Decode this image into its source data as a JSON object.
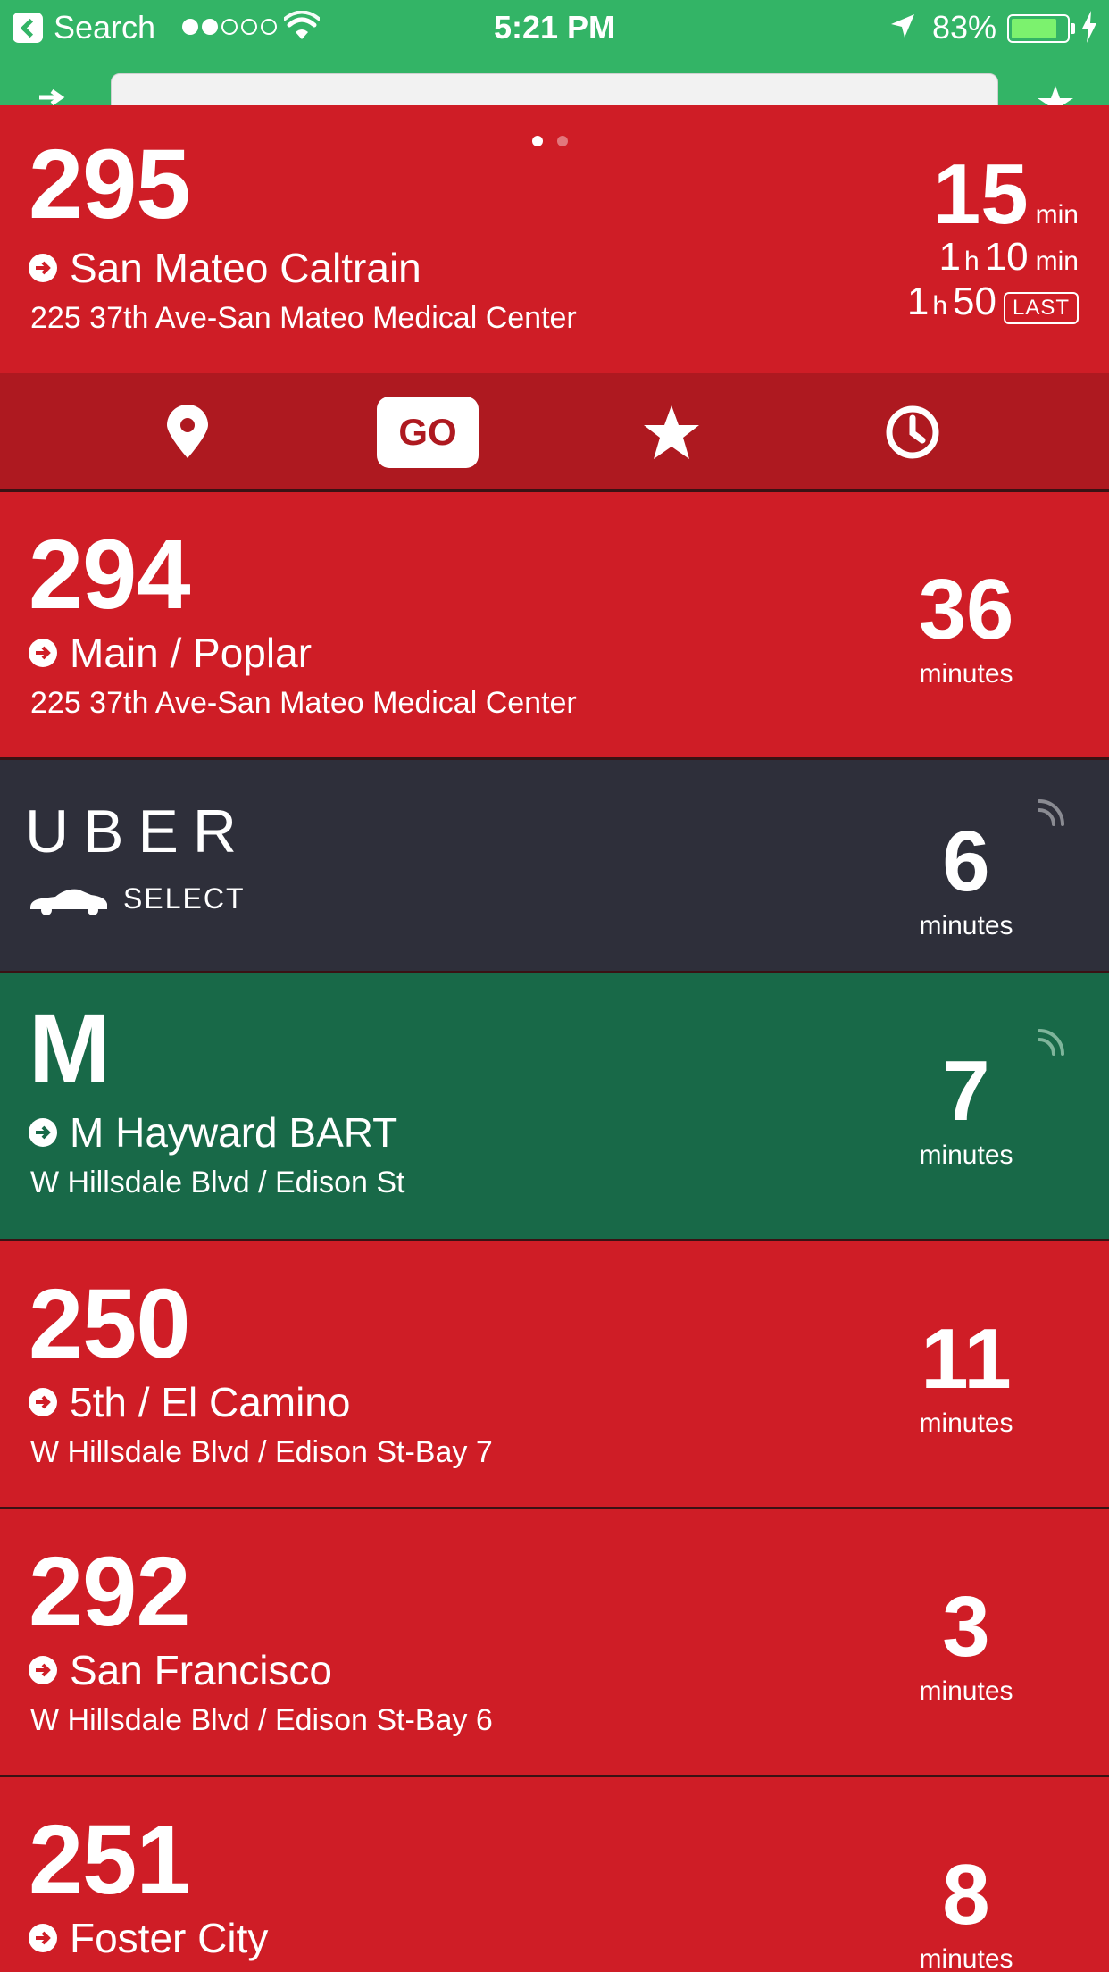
{
  "status_bar": {
    "back_label": "Search",
    "time": "5:21 PM",
    "battery_percent": "83%",
    "battery_level": 0.83,
    "signal_bars_filled": 2,
    "signal_bars_total": 5
  },
  "pager": {
    "pages": 2,
    "active": 1
  },
  "first_card": {
    "route": "295",
    "destination": "San Mateo Caltrain",
    "stop": "225 37th Ave-San Mateo Medical Center",
    "times": [
      {
        "hours": "",
        "minutes": "15",
        "unit": "min"
      },
      {
        "hours": "1",
        "hour_unit": "h",
        "minutes": "10",
        "unit": "min"
      },
      {
        "hours": "1",
        "hour_unit": "h",
        "minutes": "50",
        "badge": "LAST"
      }
    ]
  },
  "actions": {
    "go_label": "GO",
    "icons": [
      "location-pin-icon",
      "star-icon",
      "clock-icon"
    ]
  },
  "cards": [
    {
      "route": "294",
      "destination": "Main / Poplar",
      "stop": "225 37th Ave-San Mateo Medical Center",
      "eta": "36",
      "eta_unit": "minutes",
      "color": "#cf1d26"
    },
    {
      "brand": "UBER",
      "service": "SELECT",
      "eta": "6",
      "eta_unit": "minutes",
      "color": "#2e2f3a",
      "realtime": true
    },
    {
      "route": "M",
      "destination": "M Hayward BART",
      "stop": "W Hillsdale Blvd / Edison St",
      "eta": "7",
      "eta_unit": "minutes",
      "color": "#186948",
      "realtime": true
    },
    {
      "route": "250",
      "destination": "5th / El Camino",
      "stop": "W Hillsdale Blvd / Edison St-Bay 7",
      "eta": "11",
      "eta_unit": "minutes",
      "color": "#cf1d26"
    },
    {
      "route": "292",
      "destination": "San Francisco",
      "stop": "W Hillsdale Blvd / Edison St-Bay 6",
      "eta": "3",
      "eta_unit": "minutes",
      "color": "#cf1d26"
    },
    {
      "route": "251",
      "destination": "Foster City",
      "eta": "8",
      "eta_unit": "minutes",
      "color": "#cf1d26"
    }
  ],
  "colors": {
    "status_green": "#33b466",
    "route_red": "#cf1d26",
    "action_red": "#ae1920",
    "uber_dark": "#2e2f3a",
    "bart_green": "#186948"
  }
}
